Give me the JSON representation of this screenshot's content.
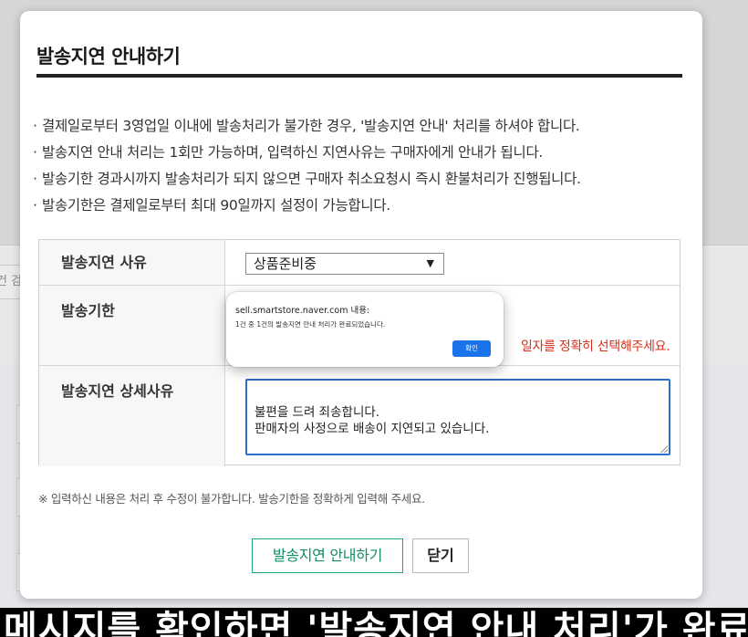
{
  "background": {
    "input_fragment": "건 검"
  },
  "modal": {
    "title": "발송지연 안내하기",
    "notices": [
      "결제일로부터 3영업일 이내에 발송처리가 불가한 경우, '발송지연 안내' 처리를 하셔야 합니다.",
      "발송지연 안내 처리는 1회만 가능하며, 입력하신 지연사유는 구매자에게 안내가 됩니다.",
      "발송기한 경과시까지 발송처리가 되지 않으면 구매자 취소요청시 즉시 환불처리가 진행됩니다.",
      "발송기한은 결제일로부터 최대 90일까지 설정이 가능합니다."
    ],
    "form": {
      "reason_label": "발송지연 사유",
      "reason_value": "상품준비중",
      "reason_arrow": "▼",
      "deadline_label": "발송기한",
      "deadline_message": "일자를 정확히 선택해주세요.",
      "detail_label": "발송지연 상세사유",
      "detail_value": "불편을 드려 죄송합니다.\n판매자의 사정으로 배송이 지연되고 있습니다."
    },
    "footnote": "※ 입력하신 내용은 처리 후 수정이 불가합니다. 발송기한을 정확하게 입력해 주세요.",
    "buttons": {
      "submit": "발송지연 안내하기",
      "close": "닫기"
    }
  },
  "alert": {
    "title": "sell.smartstore.naver.com 내용:",
    "message": "1건 중 1건의 발송지연 안내 처리가 완료되었습니다.",
    "ok": "확인"
  },
  "caption": {
    "text": "메시지를 확인하면 '발송지연 안내 처리'가 완료됩"
  }
}
